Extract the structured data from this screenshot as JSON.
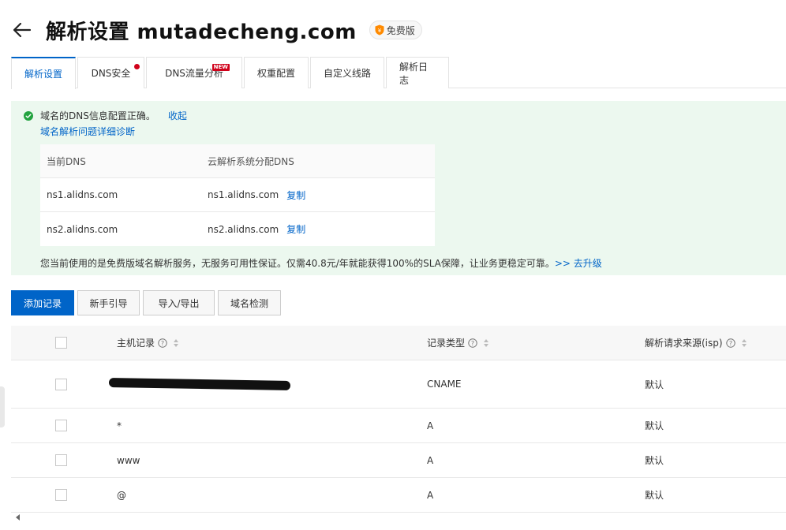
{
  "header": {
    "title": "解析设置 mutadecheng.com",
    "badge": "免费版"
  },
  "tabs": [
    {
      "label": "解析设置",
      "active": true
    },
    {
      "label": "DNS安全",
      "dot": true
    },
    {
      "label": "DNS流量分析",
      "new_label": "NEW"
    },
    {
      "label": "权重配置"
    },
    {
      "label": "自定义线路"
    },
    {
      "label": "解析日志"
    }
  ],
  "notice": {
    "status_text": "域名的DNS信息配置正确。",
    "collapse": "收起",
    "diagnose": "域名解析问题详细诊断",
    "table": {
      "col_current": "当前DNS",
      "col_assigned": "云解析系统分配DNS",
      "rows": [
        {
          "current": "ns1.alidns.com",
          "assigned": "ns1.alidns.com",
          "copy": "复制"
        },
        {
          "current": "ns2.alidns.com",
          "assigned": "ns2.alidns.com",
          "copy": "复制"
        }
      ]
    },
    "upgrade_text": "您当前使用的是免费版域名解析服务，无服务可用性保证。仅需40.8元/年就能获得100%的SLA保障，让业务更稳定可靠。",
    "upgrade_link": ">> 去升级"
  },
  "toolbar": {
    "add": "添加记录",
    "guide": "新手引导",
    "import_export": "导入/导出",
    "check": "域名检测"
  },
  "records": {
    "columns": {
      "host": "主机记录",
      "type": "记录类型",
      "isp": "解析请求来源(isp)"
    },
    "rows": [
      {
        "host": "",
        "type": "CNAME",
        "isp": "默认",
        "redacted": true
      },
      {
        "host": "*",
        "type": "A",
        "isp": "默认"
      },
      {
        "host": "www",
        "type": "A",
        "isp": "默认"
      },
      {
        "host": "@",
        "type": "A",
        "isp": "默认"
      }
    ]
  },
  "colors": {
    "primary": "#0064c8",
    "success": "#23a340",
    "notice_bg": "#ecf8ef",
    "badge_shield": "#ff8a00",
    "alert": "#d0021b"
  }
}
